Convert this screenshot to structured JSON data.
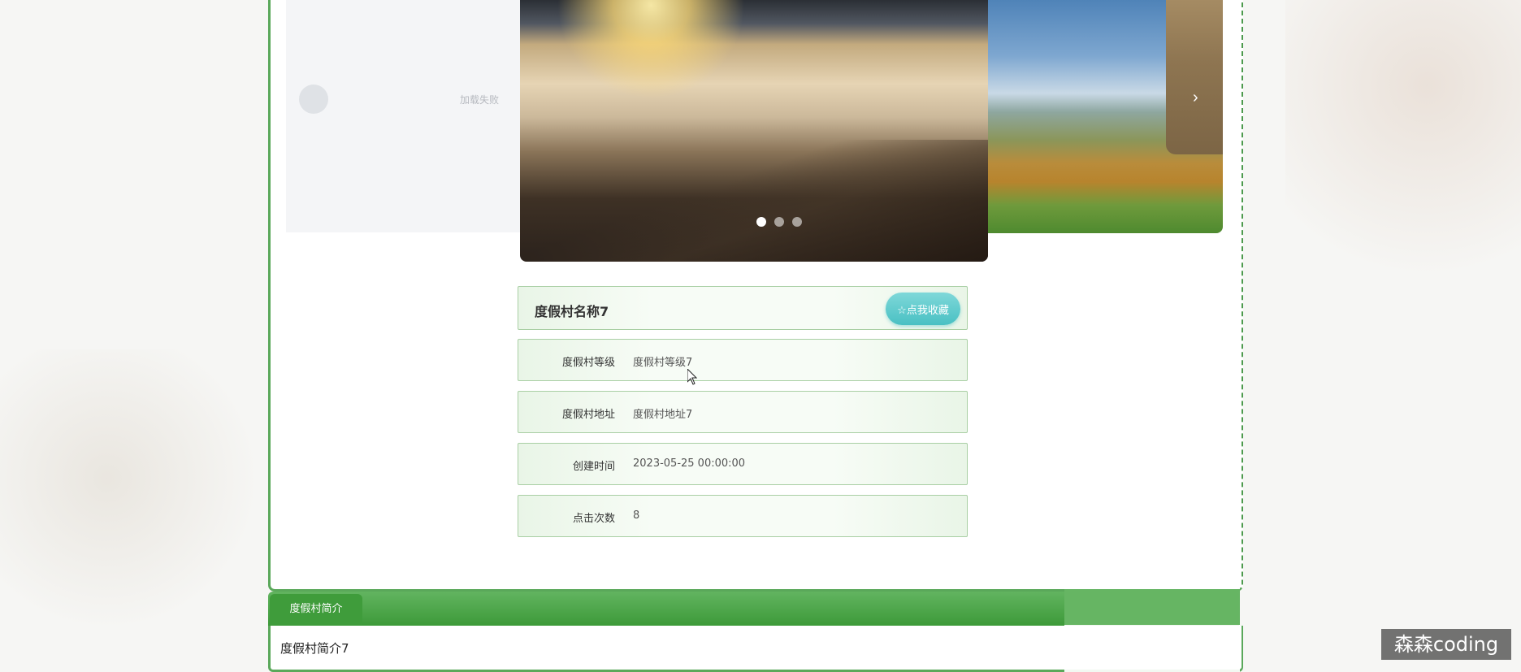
{
  "carousel": {
    "load_failed_text": "加载失败",
    "dot_count": 3,
    "active_index": 0
  },
  "resort": {
    "name": "度假村名称7",
    "favorite_button": "☆点我收藏",
    "fields": [
      {
        "label": "度假村等级",
        "value": "度假村等级7"
      },
      {
        "label": "度假村地址",
        "value": "度假村地址7"
      },
      {
        "label": "创建时间",
        "value": "2023-05-25 00:00:00"
      },
      {
        "label": "点击次数",
        "value": "8"
      }
    ]
  },
  "intro": {
    "tab_label": "度假村简介",
    "content": "度假村简介7"
  },
  "watermark": "森森coding",
  "colors": {
    "accent": "#5aa85a",
    "favorite": "#49c0c3"
  }
}
